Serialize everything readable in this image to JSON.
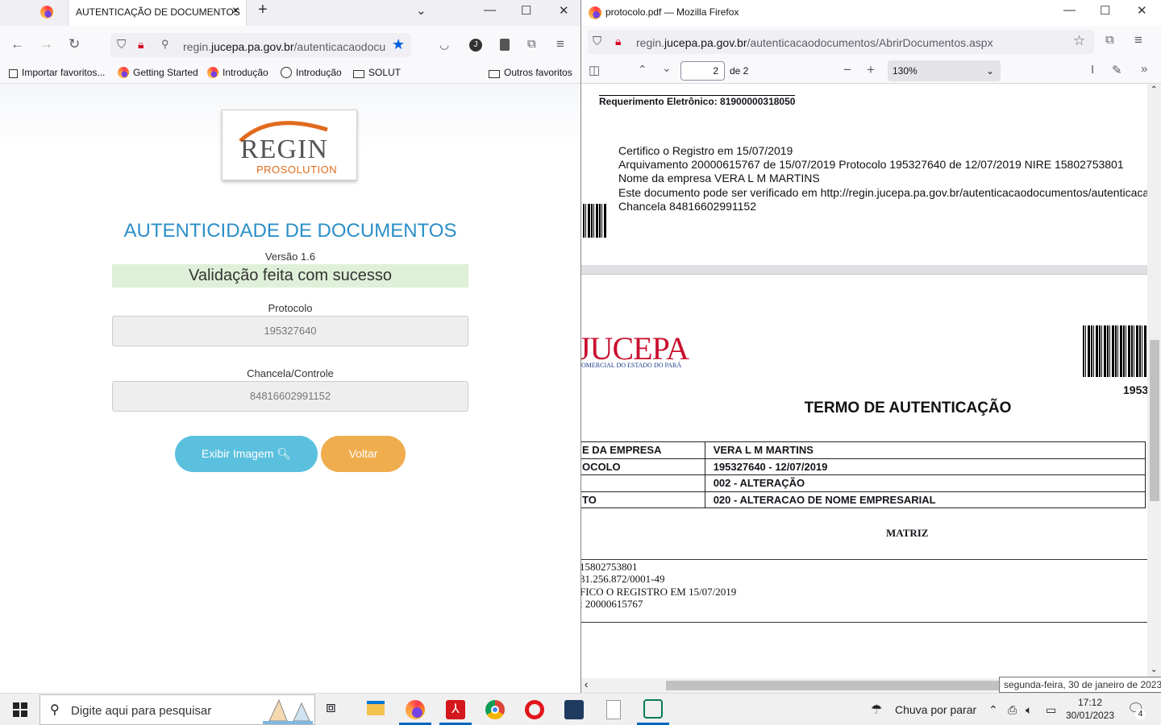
{
  "left_browser": {
    "tab_title": "AUTENTICAÇÃO DE DOCUMENTOS",
    "url_prefix": "regin.",
    "url_domain": "jucepa.pa.gov.br",
    "url_rest": "/autenticacaodocum",
    "bookmarks": [
      "Importar favoritos...",
      "Getting Started",
      "Introdução",
      "Introdução",
      "SOLUT",
      "Outros favoritos"
    ]
  },
  "page": {
    "logo_main": "REGIN",
    "logo_sub": "PROSOLUTION",
    "title": "AUTENTICIDADE DE DOCUMENTOS",
    "version": "Versão 1.6",
    "success_message": "Validação feita com sucesso",
    "protocolo_label": "Protocolo",
    "protocolo_value": "195327640",
    "chancela_label": "Chancela/Controle",
    "chancela_value": "84816602991152",
    "btn_exibir": "Exibir Imagem",
    "btn_voltar": "Voltar"
  },
  "right_browser": {
    "window_title": "protocolo.pdf — Mozilla Firefox",
    "url_prefix": "regin.",
    "url_domain": "jucepa.pa.gov.br",
    "url_rest": "/autenticacaodocumentos/AbrirDocumentos.aspx",
    "page_current": "2",
    "page_total": "de 2",
    "zoom": "130%"
  },
  "pdf": {
    "requerimento": "Requerimento Eletrônico: 81900000318050",
    "cert_lines": [
      "Certifico o Registro em 15/07/2019",
      "Arquivamento 20000615767 de 15/07/2019 Protocolo 195327640 de 12/07/2019 NIRE 15802753801",
      "Nome da empresa VERA L M MARTINS",
      "Este documento pode ser verificado em http://regin.jucepa.pa.gov.br/autenticacaodocumentos/autenticaca",
      "Chancela 84816602991152"
    ],
    "logo_text": "JUCEPA",
    "logo_sub": "OMERCIAL DO ESTADO DO PARÁ",
    "barcode_number": "1953",
    "termo_title": "TERMO DE AUTENTICAÇÃO",
    "table": [
      [
        "E DA EMPRESA",
        "VERA L M MARTINS"
      ],
      [
        "OCOLO",
        "195327640 - 12/07/2019"
      ],
      [
        "",
        "002 - ALTERAÇÃO"
      ],
      [
        "TO",
        "020 - ALTERACAO DE NOME EMPRESARIAL"
      ]
    ],
    "matriz": "MATRIZ",
    "bottom_lines": [
      "15802753801",
      "31.256.872/0001-49",
      "FICO O REGISTRO EM 15/07/2019",
      ": 20000615767"
    ]
  },
  "tooltip": "segunda-feira, 30 de janeiro de 2023",
  "taskbar": {
    "search_placeholder": "Digite aqui para pesquisar",
    "weather": "Chuva por parar",
    "time": "17:12",
    "date": "30/01/2023",
    "notifications": "4"
  }
}
